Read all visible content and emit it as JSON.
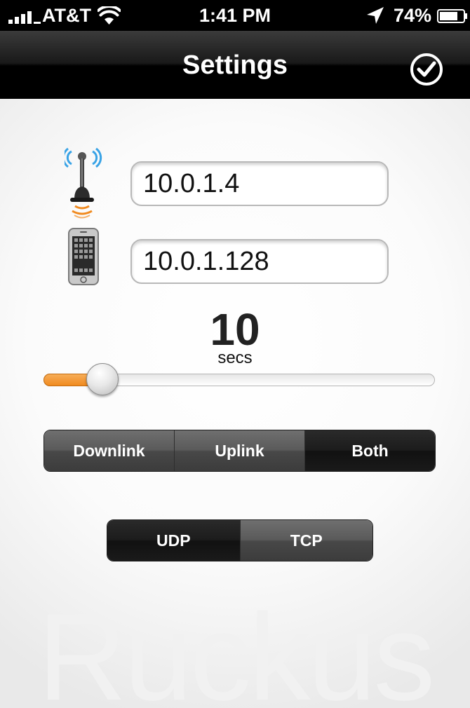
{
  "status_bar": {
    "carrier": "AT&T",
    "time": "1:41 PM",
    "battery_percent": "74%",
    "icons": [
      "signal-bars-icon",
      "wifi-icon",
      "location-arrow-icon",
      "battery-icon"
    ]
  },
  "nav": {
    "title": "Settings",
    "done_icon": "checkmark-circle-icon"
  },
  "access_point": {
    "icon": "wireless-antenna-icon",
    "value": "10.0.1.4"
  },
  "device": {
    "icon": "smartphone-icon",
    "value": "10.0.1.128"
  },
  "interval": {
    "value": "10",
    "unit": "secs",
    "slider_fraction": 0.15
  },
  "direction": {
    "options": [
      "Downlink",
      "Uplink",
      "Both"
    ],
    "selected": "Both"
  },
  "protocol": {
    "options": [
      "UDP",
      "TCP"
    ],
    "selected": "UDP"
  },
  "watermark": "Ruckus",
  "colors": {
    "slider_accent": "#f08a1f",
    "nav_background": "#000000",
    "segment_selected": "#1a1a1a",
    "segment_unselected": "#5a5a5a"
  }
}
